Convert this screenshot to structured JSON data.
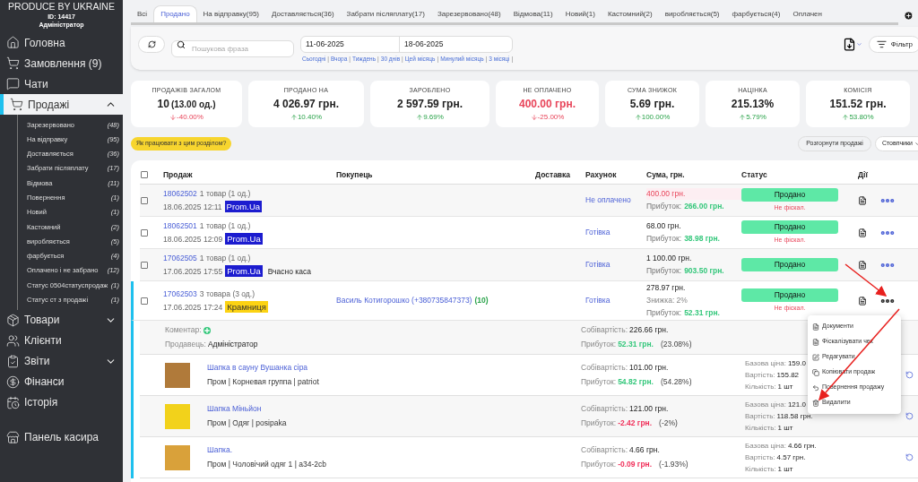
{
  "brand": {
    "name": "PRODUCE BY UKRAINE",
    "id": "ID: 14417",
    "role": "Адміністратор"
  },
  "sidebar": {
    "items": [
      {
        "kind": "link",
        "label": "Головна",
        "selected": false
      },
      {
        "kind": "link",
        "label": "Замовлення (9)",
        "selected": false
      },
      {
        "kind": "link",
        "label": "Чати",
        "selected": false
      },
      {
        "kind": "group",
        "label": "Продажі",
        "selected": true,
        "expanded": true,
        "children": [
          {
            "label": "Зарезервовано",
            "count": "(48)"
          },
          {
            "label": "На відправку",
            "count": "(95)"
          },
          {
            "label": "Доставляється",
            "count": "(36)"
          },
          {
            "label": "Забрати післяплату",
            "count": "(17)"
          },
          {
            "label": "Відмова",
            "count": "(11)"
          },
          {
            "label": "Повернення",
            "count": "(1)"
          },
          {
            "label": "Новий",
            "count": "(1)"
          },
          {
            "label": "Кастомний",
            "count": "(2)"
          },
          {
            "label": "виробляється",
            "count": "(5)"
          },
          {
            "label": "фарбується",
            "count": "(4)"
          },
          {
            "label": "Оплачено і не забрано",
            "count": "(12)"
          },
          {
            "label": "Статус 0504статуспродаж",
            "count": "(1)"
          },
          {
            "label": "Статус ст з продажі",
            "count": "(1)"
          }
        ]
      },
      {
        "kind": "group",
        "label": "Товари",
        "selected": false,
        "expanded": false
      },
      {
        "kind": "link",
        "label": "Клієнти",
        "selected": false
      },
      {
        "kind": "group",
        "label": "Звіти",
        "selected": false,
        "expanded": false
      },
      {
        "kind": "link",
        "label": "Фінанси",
        "selected": false
      },
      {
        "kind": "link",
        "label": "Історія",
        "selected": false
      },
      {
        "kind": "footer",
        "label": "Панель касира",
        "selected": false
      }
    ]
  },
  "tabs": [
    {
      "label": "Всі",
      "selected": false
    },
    {
      "label": "Продано",
      "selected": true
    },
    {
      "label": "На відправку(95)",
      "selected": false
    },
    {
      "label": "Доставляється(36)",
      "selected": false
    },
    {
      "label": "Забрати післяплату(17)",
      "selected": false
    },
    {
      "label": "Зарезервовано(48)",
      "selected": false
    },
    {
      "label": "Відмова(11)",
      "selected": false
    },
    {
      "label": "Новий(1)",
      "selected": false
    },
    {
      "label": "Кастомний(2)",
      "selected": false
    },
    {
      "label": "виробляється(5)",
      "selected": false
    },
    {
      "label": "фарбується(4)",
      "selected": false
    },
    {
      "label": "Оплачен",
      "selected": false
    }
  ],
  "filters": {
    "search_placeholder": "Пошукова фраза",
    "date_from": "11-06-2025",
    "date_to": "18-06-2025",
    "quick_ranges": [
      {
        "label": "Сьогодні",
        "separator": "|"
      },
      {
        "label": "Вчора",
        "separator": "|"
      },
      {
        "label": "Тиждень",
        "separator": "|"
      },
      {
        "label": "30 днів",
        "separator": "|"
      },
      {
        "label": "Цей місяць",
        "separator": "|"
      },
      {
        "label": "Минулий місяць",
        "separator": "|"
      },
      {
        "label": "3 місяці",
        "separator": "|"
      }
    ],
    "filter_button": "Фільтр"
  },
  "stats": [
    {
      "title": "ПРОДАЖІВ ЗАГАЛОМ",
      "value": "10",
      "sub": "(13.00 од.)",
      "alert": false,
      "change": "-40.00%",
      "falling": true
    },
    {
      "title": "ПРОДАНО НА",
      "value": "4 026.97 грн.",
      "alert": false,
      "change": "10.40%",
      "falling": false
    },
    {
      "title": "ЗАРОБЛЕНО",
      "value": "2 597.59 грн.",
      "alert": false,
      "change": "9.69%",
      "falling": false
    },
    {
      "title": "НЕ ОПЛАЧЕНО",
      "value": "400.00 грн.",
      "alert": true,
      "change": "-25.00%",
      "falling": true
    },
    {
      "title": "СУМА ЗНИЖОК",
      "value": "5.69 грн.",
      "alert": false,
      "change": "100.00%",
      "falling": false
    },
    {
      "title": "НАЦІНКА",
      "value": "215.13%",
      "alert": false,
      "change": "5.79%",
      "falling": false
    },
    {
      "title": "КОМІСІЯ",
      "value": "151.52 грн.",
      "alert": false,
      "change": "53.80%",
      "falling": false
    }
  ],
  "help_button": "Як працювати з цим розділом?",
  "expand_button": "Розгорнути продажі",
  "columns_button": "Стовпчики",
  "table": {
    "select_all_checked": false,
    "columns": [
      "Продаж",
      "Покупець",
      "Доставка",
      "Рахунок",
      "Сума, грн.",
      "Статус",
      "Дії"
    ],
    "rows": [
      {
        "id": "18062502",
        "items": "1 товар (1 од.)",
        "date": "18.06.2025 12:11",
        "badge": {
          "text": "Prom.Ua",
          "color": "#1c1ccf"
        },
        "extra": "",
        "buyer": "",
        "buyer_count": "",
        "account": "Не оплачено",
        "amount": "400.00 грн.",
        "unpaid": true,
        "discount": "",
        "profit_label": "Прибуток:",
        "profit": "266.00 грн.",
        "status": "Продано",
        "fiscal": "Не фіскал.",
        "expanded": false,
        "checked": false
      },
      {
        "id": "18062501",
        "items": "1 товар (1 од.)",
        "date": "18.06.2025 12:09",
        "badge": {
          "text": "Prom.Ua",
          "color": "#1c1ccf"
        },
        "extra": "",
        "buyer": "",
        "buyer_count": "",
        "account": "Готівка",
        "amount": "68.00 грн.",
        "unpaid": false,
        "discount": "",
        "profit_label": "Прибуток:",
        "profit": "38.98 грн.",
        "status": "Продано",
        "fiscal": "Не фіскал.",
        "expanded": false,
        "checked": false
      },
      {
        "id": "17062505",
        "items": "1 товар (1 од.)",
        "date": "17.06.2025 17:55",
        "badge": {
          "text": "Prom.Ua",
          "color": "#1c1ccf"
        },
        "extra": "Вчасно каса",
        "buyer": "",
        "buyer_count": "",
        "account": "Готівка",
        "amount": "1 100.00 грн.",
        "unpaid": false,
        "discount": "",
        "profit_label": "Прибуток:",
        "profit": "903.50 грн.",
        "status": "Продано",
        "fiscal": "",
        "expanded": false,
        "checked": false
      },
      {
        "id": "17062503",
        "items": "3 товара (3 од.)",
        "date": "17.06.2025 17:24",
        "badge": {
          "text": "Крамниця",
          "color": "#fcd313"
        },
        "extra": "",
        "buyer": "Василь Котигорошко (+380735847373)",
        "buyer_count": "(10)",
        "account": "Готівка",
        "amount": "278.97 грн.",
        "unpaid": false,
        "discount": "Знижка: 2%",
        "profit_label": "Прибуток:",
        "profit": "52.31 грн.",
        "status": "Продано",
        "fiscal": "Не фіскал.",
        "expanded": true,
        "checked": false
      }
    ]
  },
  "details": {
    "comment_label": "Коментар:",
    "seller_label": "Продавець:",
    "seller": "Адміністратор",
    "cost_label": "Собівартість:",
    "cost": "226.66 грн.",
    "profit_label": "Прибуток:",
    "profit": "52.31 грн.",
    "margin": "(23.08%)",
    "items": [
      {
        "name": "Шапка в сауну Вушанка сіра",
        "meta": "Пром | Корневая группа | patriot",
        "cost_label": "Собівартість:",
        "cost": "101.00 грн.",
        "profit_label": "Прибуток:",
        "profit": "54.82 грн.",
        "loss": false,
        "margin": "(54.28%)",
        "base_label": "Базова ціна:",
        "base": "159.0",
        "value_label": "Вартість:",
        "value": "155.82",
        "qty_label": "Кількість:",
        "qty": "1 шт"
      },
      {
        "name": "Шапка Міньйон",
        "meta": "Пром | Одяг | posipaka",
        "cost_label": "Собівартість:",
        "cost": "121.00 грн.",
        "profit_label": "Прибуток:",
        "profit": "-2.42 грн.",
        "loss": true,
        "margin": "(-2%)",
        "base_label": "Базова ціна:",
        "base": "121.0",
        "value_label": "Вартість:",
        "value": "118.58 грн.",
        "qty_label": "Кількість:",
        "qty": "1 шт"
      },
      {
        "name": "Шапка.",
        "meta": "Пром | Чоловічий одяг 1 | a34-2cb",
        "cost_label": "Собівартість:",
        "cost": "4.66 грн.",
        "profit_label": "Прибуток:",
        "profit": "-0.09 грн.",
        "loss": true,
        "margin": "(-1.93%)",
        "base_label": "Базова ціна:",
        "base": "4.66 грн.",
        "value_label": "Вартість:",
        "value": "4.57 грн.",
        "qty_label": "Кількість:",
        "qty": "1 шт"
      }
    ]
  },
  "menu": [
    {
      "label": "Документи"
    },
    {
      "label": "Фіскалізувати чек"
    },
    {
      "label": "Редагувати"
    },
    {
      "label": "Копіювати продаж"
    },
    {
      "label": "Повернення продажу"
    },
    {
      "label": "Видалити"
    }
  ]
}
